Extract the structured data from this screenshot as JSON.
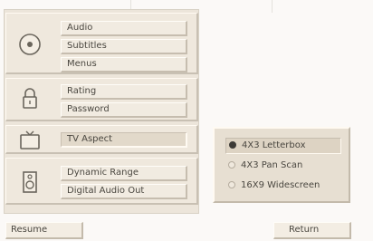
{
  "menu": {
    "audio_group": {
      "icon": "disc-icon",
      "items": [
        "Audio",
        "Subtitles",
        "Menus"
      ]
    },
    "lock_group": {
      "icon": "padlock-icon",
      "items": [
        "Rating",
        "Password"
      ]
    },
    "tv_group": {
      "icon": "tv-icon",
      "items": [
        "TV Aspect"
      ]
    },
    "speaker_group": {
      "icon": "speaker-icon",
      "items": [
        "Dynamic Range",
        "Digital Audio Out"
      ]
    }
  },
  "aspect_options": {
    "selected": "4X3 Letterbox",
    "items": [
      "4X3 Letterbox",
      "4X3 Pan Scan",
      "16X9 Widescreen"
    ]
  },
  "buttons": {
    "resume": "Resume",
    "return": "Return"
  },
  "colors": {
    "background": "#fbf9f7",
    "panel": "#ece5da",
    "text": "#3c3a36"
  }
}
